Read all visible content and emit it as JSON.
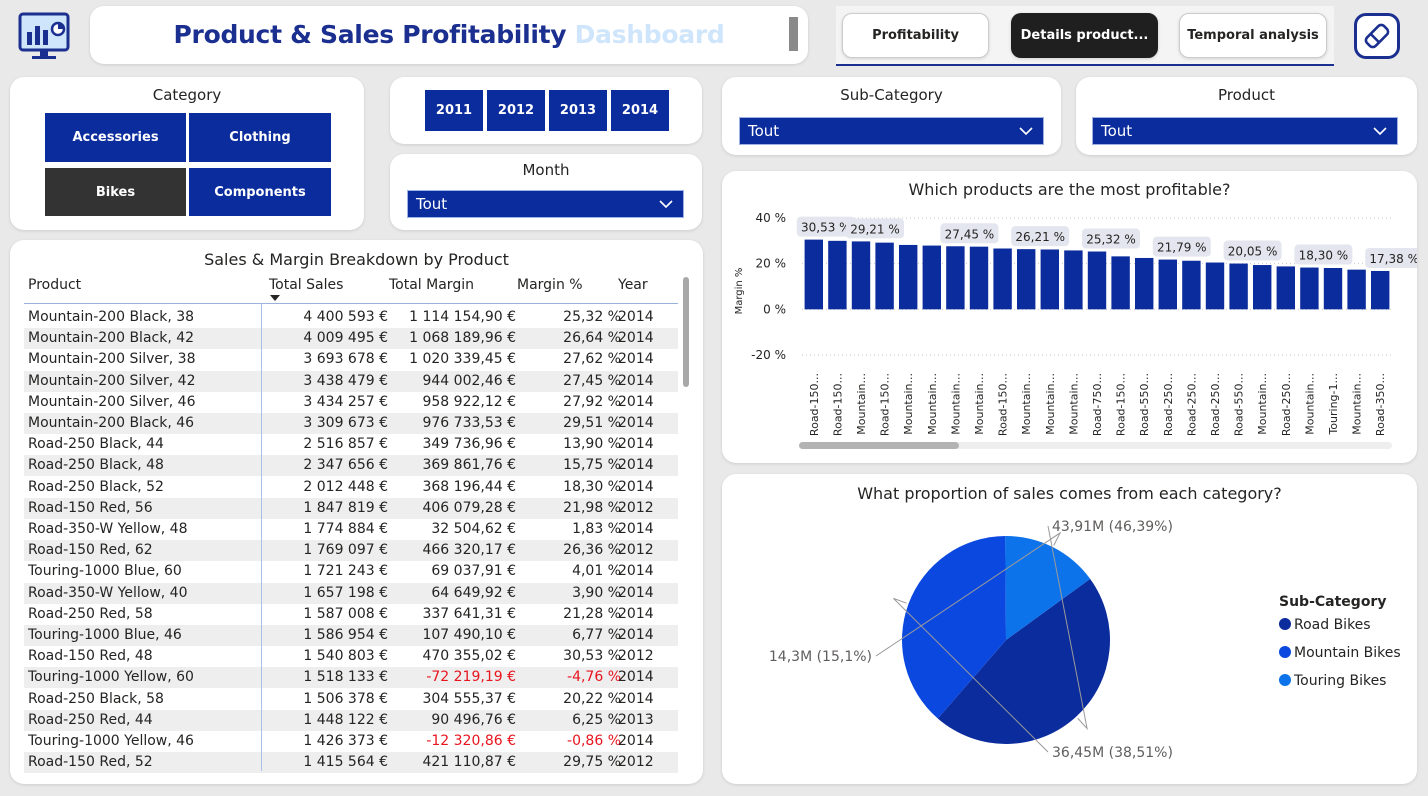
{
  "header": {
    "title_main": "Product & Sales Profitability",
    "title_accent": "Dashboard",
    "nav": [
      {
        "label": "Profitability",
        "active": false
      },
      {
        "label": "Details product...",
        "active": true
      },
      {
        "label": "Temporal analysis",
        "active": false
      }
    ]
  },
  "slicers": {
    "category": {
      "title": "Category",
      "options": [
        {
          "label": "Accessories",
          "selected": false
        },
        {
          "label": "Clothing",
          "selected": false
        },
        {
          "label": "Bikes",
          "selected": true
        },
        {
          "label": "Components",
          "selected": false
        }
      ]
    },
    "years": [
      "2011",
      "2012",
      "2013",
      "2014"
    ],
    "month": {
      "title": "Month",
      "value": "Tout"
    },
    "subcategory": {
      "title": "Sub-Category",
      "value": "Tout"
    },
    "product": {
      "title": "Product",
      "value": "Tout"
    }
  },
  "table": {
    "title": "Sales & Margin Breakdown by Product",
    "columns": [
      "Product",
      "Total Sales",
      "Total Margin",
      "Margin %",
      "Year"
    ],
    "rows": [
      [
        "Mountain-200 Black, 38",
        "4 400 593 €",
        "1 114 154,90 €",
        "25,32 %",
        "2014"
      ],
      [
        "Mountain-200 Black, 42",
        "4 009 495 €",
        "1 068 189,96 €",
        "26,64 %",
        "2014"
      ],
      [
        "Mountain-200 Silver, 38",
        "3 693 678 €",
        "1 020 339,45 €",
        "27,62 %",
        "2014"
      ],
      [
        "Mountain-200 Silver, 42",
        "3 438 479 €",
        "944 002,46 €",
        "27,45 %",
        "2014"
      ],
      [
        "Mountain-200 Silver, 46",
        "3 434 257 €",
        "958 922,12 €",
        "27,92 %",
        "2014"
      ],
      [
        "Mountain-200 Black, 46",
        "3 309 673 €",
        "976 733,53 €",
        "29,51 %",
        "2014"
      ],
      [
        "Road-250 Black, 44",
        "2 516 857 €",
        "349 736,96 €",
        "13,90 %",
        "2014"
      ],
      [
        "Road-250 Black, 48",
        "2 347 656 €",
        "369 861,76 €",
        "15,75 %",
        "2014"
      ],
      [
        "Road-250 Black, 52",
        "2 012 448 €",
        "368 196,44 €",
        "18,30 %",
        "2014"
      ],
      [
        "Road-150 Red, 56",
        "1 847 819 €",
        "406 079,28 €",
        "21,98 %",
        "2012"
      ],
      [
        "Road-350-W Yellow, 48",
        "1 774 884 €",
        "32 504,62 €",
        "1,83 %",
        "2014"
      ],
      [
        "Road-150 Red, 62",
        "1 769 097 €",
        "466 320,17 €",
        "26,36 %",
        "2012"
      ],
      [
        "Touring-1000 Blue, 60",
        "1 721 243 €",
        "69 037,91 €",
        "4,01 %",
        "2014"
      ],
      [
        "Road-350-W Yellow, 40",
        "1 657 198 €",
        "64 649,92 €",
        "3,90 %",
        "2014"
      ],
      [
        "Road-250 Red, 58",
        "1 587 008 €",
        "337 641,31 €",
        "21,28 %",
        "2014"
      ],
      [
        "Touring-1000 Blue, 46",
        "1 586 954 €",
        "107 490,10 €",
        "6,77 %",
        "2014"
      ],
      [
        "Road-150 Red, 48",
        "1 540 803 €",
        "470 355,02 €",
        "30,53 %",
        "2012"
      ],
      [
        "Touring-1000 Yellow, 60",
        "1 518 133 €",
        "-72 219,19 €",
        "-4,76 %",
        "2014"
      ],
      [
        "Road-250 Black, 58",
        "1 506 378 €",
        "304 555,37 €",
        "20,22 %",
        "2014"
      ],
      [
        "Road-250 Red, 44",
        "1 448 122 €",
        "90 496,76 €",
        "6,25 %",
        "2013"
      ],
      [
        "Touring-1000 Yellow, 46",
        "1 426 373 €",
        "-12 320,86 €",
        "-0,86 %",
        "2014"
      ],
      [
        "Road-150 Red, 52",
        "1 415 564 €",
        "421 110,87 €",
        "29,75 %",
        "2012"
      ]
    ]
  },
  "chart_data": [
    {
      "type": "bar",
      "title": "Which products are the most profitable?",
      "ylabel": "Margin %",
      "xlabel": "",
      "ylim": [
        -20,
        40
      ],
      "yticks": [
        "40 %",
        "20 %",
        "0 %",
        "-20 %"
      ],
      "ytick_values": [
        40,
        20,
        0,
        -20
      ],
      "categories": [
        "Road-150...",
        "Road-150...",
        "Mountain...",
        "Road-150...",
        "Mountain...",
        "Mountain...",
        "Mountain...",
        "Mountain...",
        "Road-150...",
        "Mountain...",
        "Mountain...",
        "Mountain...",
        "Road-750...",
        "Road-150...",
        "Road-550...",
        "Road-250...",
        "Road-250...",
        "Road-250...",
        "Road-550...",
        "Mountain...",
        "Road-250...",
        "Mountain...",
        "Touring-1...",
        "Mountain...",
        "Road-350..."
      ],
      "values": [
        30.53,
        30.0,
        29.75,
        29.21,
        28.2,
        27.92,
        27.62,
        27.45,
        26.64,
        26.36,
        26.21,
        25.8,
        25.32,
        23.2,
        22.5,
        21.79,
        21.28,
        20.5,
        20.05,
        19.4,
        18.8,
        18.3,
        18.1,
        17.38,
        16.8
      ],
      "data_labels": [
        {
          "index": 0,
          "text": "30,53 %"
        },
        {
          "index": 2,
          "text": "29,21 %"
        },
        {
          "index": 6,
          "text": "27,45 %"
        },
        {
          "index": 9,
          "text": "26,21 %"
        },
        {
          "index": 12,
          "text": "25,32 %"
        },
        {
          "index": 15,
          "text": "21,79 %"
        },
        {
          "index": 18,
          "text": "20,05 %"
        },
        {
          "index": 21,
          "text": "18,30 %"
        },
        {
          "index": 24,
          "text": "17,38 %"
        }
      ],
      "grid": true,
      "color": "#0b2c9d"
    },
    {
      "type": "pie",
      "title": "What proportion of sales comes from each category?",
      "legend_title": "Sub-Category",
      "legend_position": "right",
      "labels": [
        "Road Bikes",
        "Mountain Bikes",
        "Touring Bikes"
      ],
      "values": [
        43.91,
        36.45,
        14.3
      ],
      "percents": [
        46.39,
        38.51,
        15.1
      ],
      "data_labels": [
        "43,91M (46,39%)",
        "36,45M (38,51%)",
        "14,3M (15,1%)"
      ],
      "colors": [
        "#0b2c9d",
        "#0a48e0",
        "#0d73eb"
      ]
    }
  ]
}
